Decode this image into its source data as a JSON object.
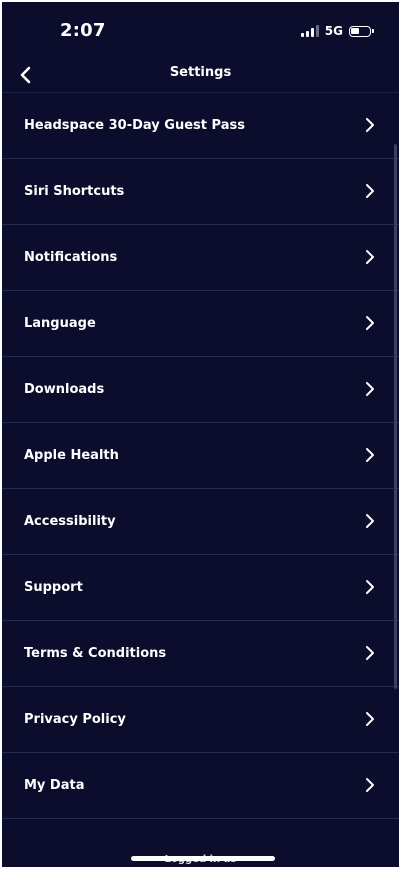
{
  "status_bar": {
    "time": "2:07",
    "network": "5G",
    "signal_bars_active": 3,
    "battery_level_fraction": 0.45
  },
  "header": {
    "title": "Settings",
    "back_icon": "chevron-left-icon"
  },
  "settings": {
    "items": [
      {
        "label": "Headspace 30-Day Guest Pass",
        "icon": "chevron-right-icon"
      },
      {
        "label": "Siri Shortcuts",
        "icon": "chevron-right-icon"
      },
      {
        "label": "Notifications",
        "icon": "chevron-right-icon"
      },
      {
        "label": "Language",
        "icon": "chevron-right-icon"
      },
      {
        "label": "Downloads",
        "icon": "chevron-right-icon"
      },
      {
        "label": "Apple Health",
        "icon": "chevron-right-icon"
      },
      {
        "label": "Accessibility",
        "icon": "chevron-right-icon"
      },
      {
        "label": "Support",
        "icon": "chevron-right-icon"
      },
      {
        "label": "Terms & Conditions",
        "icon": "chevron-right-icon"
      },
      {
        "label": "Privacy Policy",
        "icon": "chevron-right-icon"
      },
      {
        "label": "My Data",
        "icon": "chevron-right-icon"
      }
    ]
  },
  "footer": {
    "logged_in_text": "Logged in as"
  },
  "colors": {
    "background": "#0c0c2c",
    "divider": "#262a52",
    "text": "#ffffff"
  }
}
